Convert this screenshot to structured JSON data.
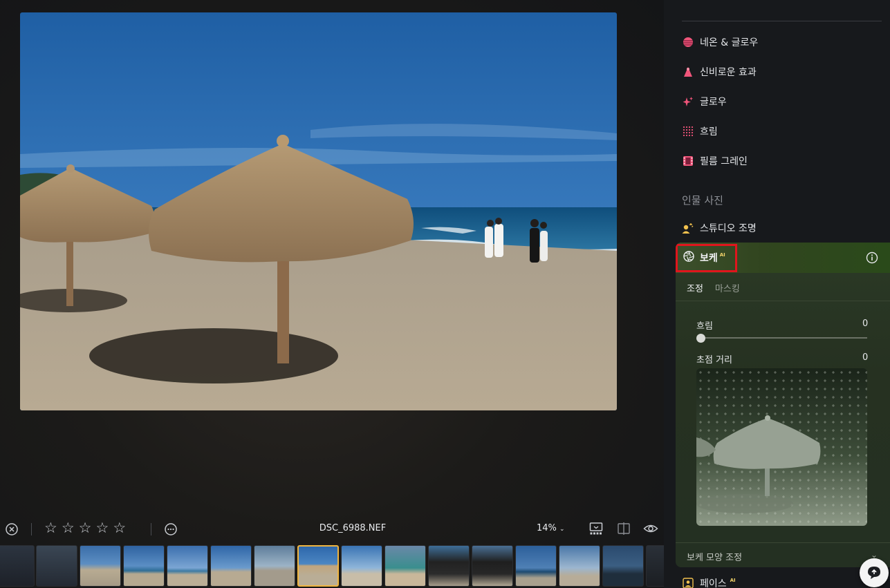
{
  "toolbar": {
    "filename": "DSC_6988.NEF",
    "zoom": "14%",
    "rating": 0
  },
  "panel": {
    "items": [
      {
        "label": "네온 & 글로우",
        "icon": "neon-glow-icon"
      },
      {
        "label": "신비로운 효과",
        "icon": "mystical-icon"
      },
      {
        "label": "글로우",
        "icon": "sparkle-icon"
      },
      {
        "label": "흐림",
        "icon": "blur-grid-icon"
      },
      {
        "label": "필름 그레인",
        "icon": "film-icon"
      }
    ],
    "section_portrait": "인물 사진",
    "studio_light": "스튜디오 조명",
    "bokeh": {
      "title": "보케",
      "ai_badge": "AI",
      "tabs": [
        "조정",
        "마스킹"
      ],
      "blur_label": "흐림",
      "blur_value": "0",
      "blur_level": 0,
      "focus_label": "초점 거리",
      "focus_value": "0",
      "shape_adjust": "보케 모양 조정"
    },
    "face": "페이스",
    "face_ai_badge": "AI"
  },
  "colors": {
    "accent_selected": "#f0b540",
    "highlight_box": "#e0151d",
    "ai_badge": "#f2d46a",
    "bokeh_header": "#31451f"
  }
}
